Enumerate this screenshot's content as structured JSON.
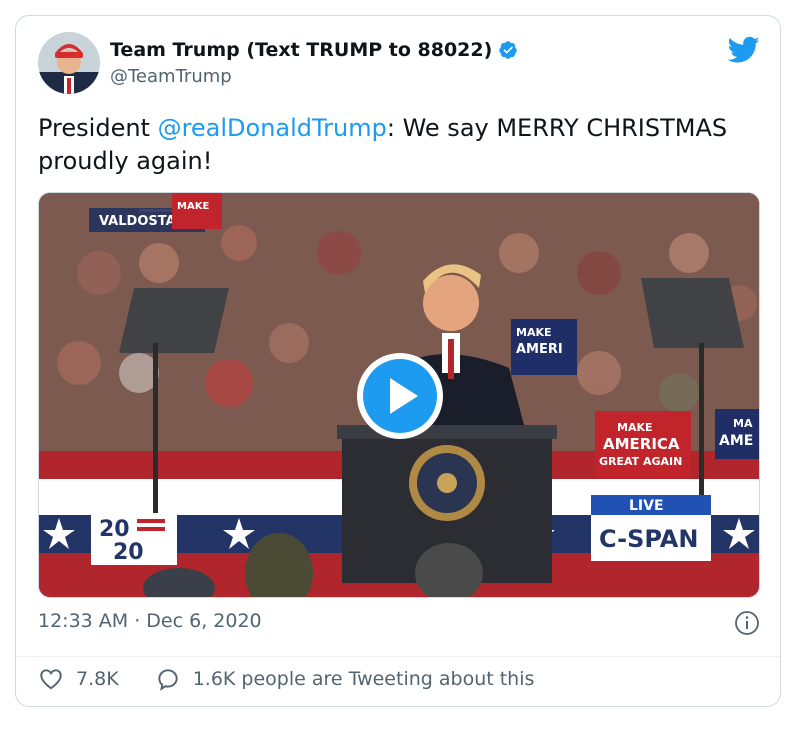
{
  "tweet": {
    "display_name": "Team Trump (Text TRUMP to 88022)",
    "handle": "@TeamTrump",
    "text_before": "President ",
    "mention": "@realDonaldTrump",
    "text_after": ": We say MERRY CHRISTMAS proudly again!",
    "timestamp": "12:33 AM · Dec 6, 2020"
  },
  "media": {
    "location_caption": "VALDOSTA, GA",
    "live_label": "LIVE",
    "network_label": "C-SPAN",
    "logo_2020_top": "20",
    "logo_2020_bottom": "20",
    "sign_left_top": "MAKE",
    "sign_right_line1": "MAKE",
    "sign_right_line2": "AMERICA",
    "sign_right_line3": "GREAT AGAIN",
    "sign_mid_line1": "MAKE",
    "sign_mid_line2": "AMERI",
    "sign_far_right_line1": "MA",
    "sign_far_right_line2": "AME"
  },
  "actions": {
    "likes": "7.8K",
    "replies": "1.6K people are Tweeting about this"
  },
  "icons": {
    "verified": "verified-badge-icon",
    "brand": "twitter-bird-icon",
    "play": "play-icon",
    "info": "info-icon",
    "like": "heart-icon",
    "reply": "speech-bubble-icon"
  },
  "colors": {
    "accent": "#1d9bf0",
    "secondary_text": "#536471",
    "border": "#cfd9de"
  }
}
